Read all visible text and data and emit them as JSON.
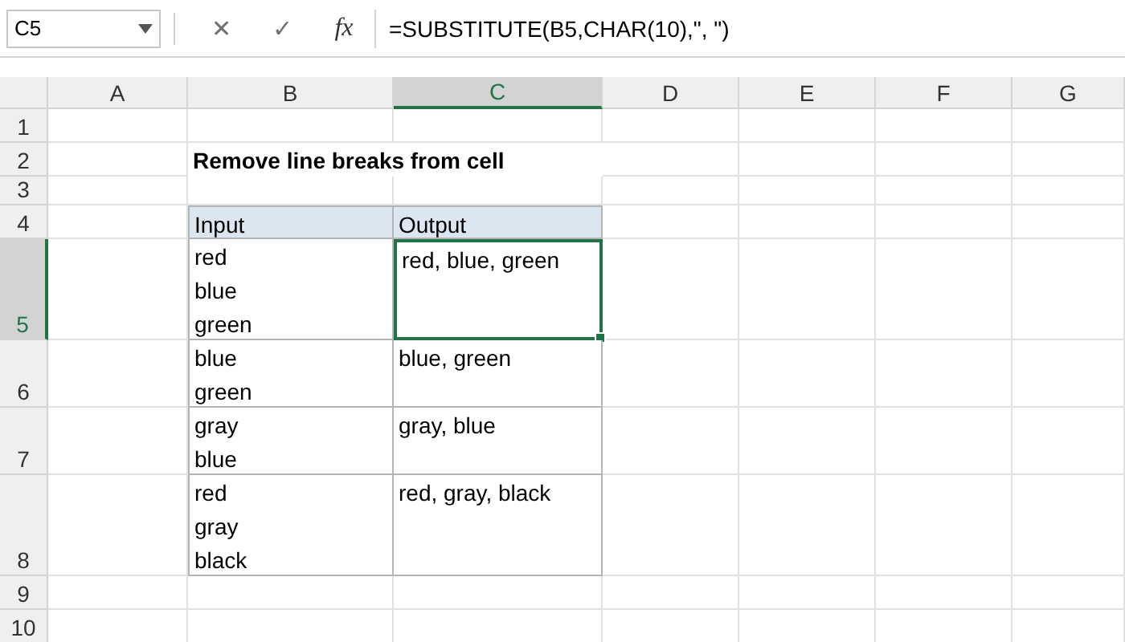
{
  "name_box": "C5",
  "formula_bar": {
    "cancel": "✕",
    "enter": "✓",
    "function": "fx",
    "formula": "=SUBSTITUTE(B5,CHAR(10),\", \")"
  },
  "columns": [
    {
      "label": "A",
      "selected": false
    },
    {
      "label": "B",
      "selected": false
    },
    {
      "label": "C",
      "selected": true
    },
    {
      "label": "D",
      "selected": false
    },
    {
      "label": "E",
      "selected": false
    },
    {
      "label": "F",
      "selected": false
    },
    {
      "label": "G",
      "selected": false
    }
  ],
  "row_headers": [
    {
      "label": "1",
      "selected": false
    },
    {
      "label": "2",
      "selected": false
    },
    {
      "label": "3",
      "selected": false
    },
    {
      "label": "4",
      "selected": false
    },
    {
      "label": "5",
      "selected": true
    },
    {
      "label": "6",
      "selected": false
    },
    {
      "label": "7",
      "selected": false
    },
    {
      "label": "8",
      "selected": false
    },
    {
      "label": "9",
      "selected": false
    },
    {
      "label": "10",
      "selected": false
    }
  ],
  "title": "Remove line breaks from cell",
  "table": {
    "columns": [
      "Input",
      "Output"
    ],
    "rows": [
      {
        "input": [
          "red",
          "blue",
          "green"
        ],
        "output": "red, blue, green",
        "selected": true
      },
      {
        "input": [
          "blue",
          "green"
        ],
        "output": "blue, green",
        "selected": false
      },
      {
        "input": [
          "gray",
          "blue"
        ],
        "output": "gray, blue",
        "selected": false
      },
      {
        "input": [
          "red",
          "gray",
          "black"
        ],
        "output": "red, gray, black",
        "selected": false
      }
    ]
  }
}
